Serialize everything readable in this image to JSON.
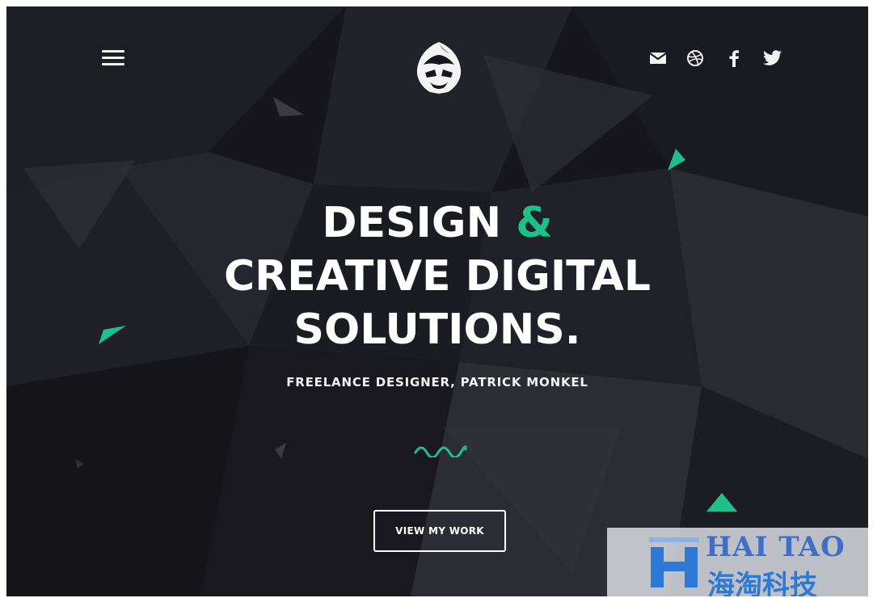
{
  "header": {
    "menu_icon": "hamburger-icon",
    "logo_icon": "masked-head-logo",
    "social_icons": [
      "mail-icon",
      "dribbble-icon",
      "facebook-icon",
      "twitter-icon"
    ]
  },
  "hero": {
    "line1_word": "DESIGN",
    "line1_amp": "&",
    "line2": "CREATIVE DIGITAL",
    "line3": "SOLUTIONS.",
    "subtitle": "FREELANCE DESIGNER, PATRICK MONKEL"
  },
  "cta": {
    "label": "VIEW MY WORK"
  },
  "watermark": {
    "top": "HAI TAO",
    "bottom": "海淘科技"
  },
  "colors": {
    "accent": "#1dc08a",
    "background": "#16161c",
    "text": "#ffffff"
  }
}
